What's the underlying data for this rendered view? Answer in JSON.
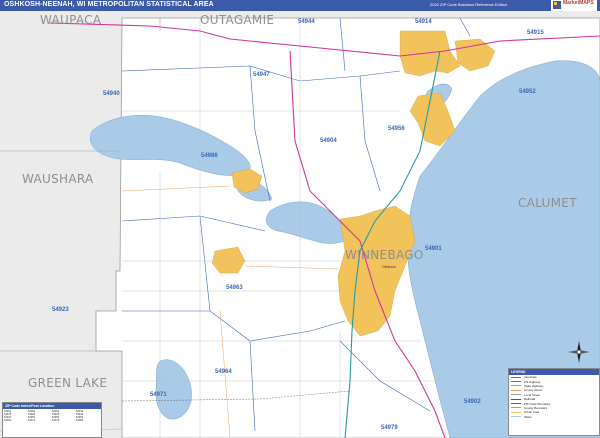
{
  "title": "OSHKOSH-NEENAH, WI METROPOLITAN STATISTICAL AREA",
  "subtitle": "2020 ZIP Code Business Reference Edition",
  "logo": {
    "brand": "MarketMAPS"
  },
  "counties": {
    "waupaca": "WAUPACA",
    "outagamie": "OUTAGAMIE",
    "waushara": "WAUSHARA",
    "calumet": "CALUMET",
    "winnebago": "WINNEBAGO",
    "green_lake": "GREEN LAKE"
  },
  "zip_codes": [
    {
      "code": "54944"
    },
    {
      "code": "54914"
    },
    {
      "code": "54915"
    },
    {
      "code": "54947"
    },
    {
      "code": "54940"
    },
    {
      "code": "54952"
    },
    {
      "code": "54956"
    },
    {
      "code": "54904"
    },
    {
      "code": "54986"
    },
    {
      "code": "54901"
    },
    {
      "code": "54963"
    },
    {
      "code": "54923"
    },
    {
      "code": "54964"
    },
    {
      "code": "54971"
    },
    {
      "code": "54979"
    },
    {
      "code": "54902"
    }
  ],
  "places": {
    "oshkosh": "Oshkosh"
  },
  "legend": {
    "title": "LEGEND",
    "items": [
      {
        "label": "Interstate",
        "color": "#d1359a"
      },
      {
        "label": "US Highway",
        "color": "#d1359a"
      },
      {
        "label": "State Highway",
        "color": "#e07ab8"
      },
      {
        "label": "County Road",
        "color": "#f0a060"
      },
      {
        "label": "Local Street",
        "color": "#9a9a9a"
      },
      {
        "label": "Railroad",
        "color": "#555555"
      },
      {
        "label": "ZIP Code Boundary",
        "color": "#3a66b8"
      },
      {
        "label": "County Boundary",
        "color": "#a0a0a0"
      },
      {
        "label": "Urban Area",
        "color": "#f2c35b"
      },
      {
        "label": "Water",
        "color": "#a9cbe8"
      }
    ]
  },
  "index": {
    "title": "ZIP Code Index/Post Location",
    "entries": [
      "54901",
      "54902",
      "54904",
      "54914",
      "54915",
      "54923",
      "54940",
      "54944",
      "54947",
      "54952",
      "54956",
      "54963",
      "54964",
      "54971",
      "54979",
      "54986"
    ]
  },
  "colors": {
    "water": "#a9cbe8",
    "urban": "#f2c35b",
    "outside": "#ebebeb",
    "roads": "#d1359a",
    "zip_boundary": "#3a66b8"
  },
  "compass_icon": "compass-rose-icon"
}
